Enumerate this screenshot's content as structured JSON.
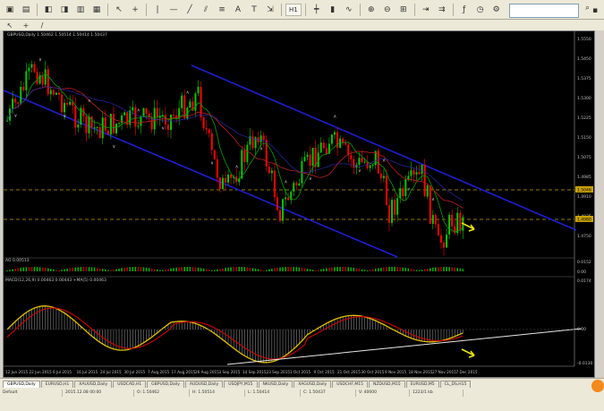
{
  "toolbar": {
    "timeframe_label": "H1",
    "search_placeholder": ""
  },
  "chart": {
    "symbol_label": "GBPUSD,Daily 1.50462 1.50514 1.50414 1.50437",
    "osc_label": "AO 0.00513",
    "macd_label": "MACD(12,26,9) 0.00463 0.00443 +MA(5) 0.00463",
    "price_levels": [
      "1.5550",
      "1.5450",
      "1.5375",
      "1.5300",
      "1.5225",
      "1.5150",
      "1.5075",
      "1.4985",
      "1.4910",
      "1.4835",
      "1.4750"
    ],
    "highlight_levels": [
      "1.5046",
      "1.4980"
    ],
    "macd_levels": [
      "0.0174",
      "0.00",
      "-0.0130"
    ],
    "osc_levels": [
      "0.0152",
      "0.00"
    ],
    "dates": [
      "12 Jun 2015",
      "22 Jun 2015",
      "6 Jul 2015",
      "16 Jul 2015",
      "24 Jul 2015",
      "30 Jul 2015",
      "7 Aug 2015",
      "17 Aug 2015",
      "26 Aug 2015",
      "3 Sep 2015",
      "14 Sep 2015",
      "23 Sep 2015",
      "1 Oct 2015",
      "9 Oct 2015",
      "21 Oct 2015",
      "30 Oct 2015",
      "9 Nov 2015",
      "18 Nov 2015",
      "27 Nov 2015",
      "7 Dec 2015"
    ]
  },
  "tabs": [
    {
      "label": "GBPUSD,Daily",
      "active": true
    },
    {
      "label": "EURUSD,H1",
      "active": false
    },
    {
      "label": "XAUUSD,Daily",
      "active": false
    },
    {
      "label": "USDCAD,H1",
      "active": false
    },
    {
      "label": "GBPUSD,Daily",
      "active": false
    },
    {
      "label": "AUDUSD,Daily",
      "active": false
    },
    {
      "label": "USDJPY,M15",
      "active": false
    },
    {
      "label": "NKUSD,Daily",
      "active": false
    },
    {
      "label": "XAGUSD,Daily",
      "active": false
    },
    {
      "label": "USDCHF,M15",
      "active": false
    },
    {
      "label": "NZDUSD,M15",
      "active": false
    },
    {
      "label": "EURUSD,M5",
      "active": false
    },
    {
      "label": "CL_DS,H15",
      "active": false
    }
  ],
  "status": {
    "help_text": "Default",
    "cells": [
      "Default",
      "2015.12.08 00:00",
      "O: 1.50462",
      "H: 1.50514",
      "L: 1.50414",
      "C: 1.50437",
      "V: 40000",
      "1223/1 kb"
    ]
  },
  "colors": {
    "channel": "#1e1ed2",
    "bull": "#00c800",
    "bear": "#ff0000",
    "dashed": "#c8a000",
    "macd_line": "#e0c000",
    "signal_line": "#d00000"
  }
}
